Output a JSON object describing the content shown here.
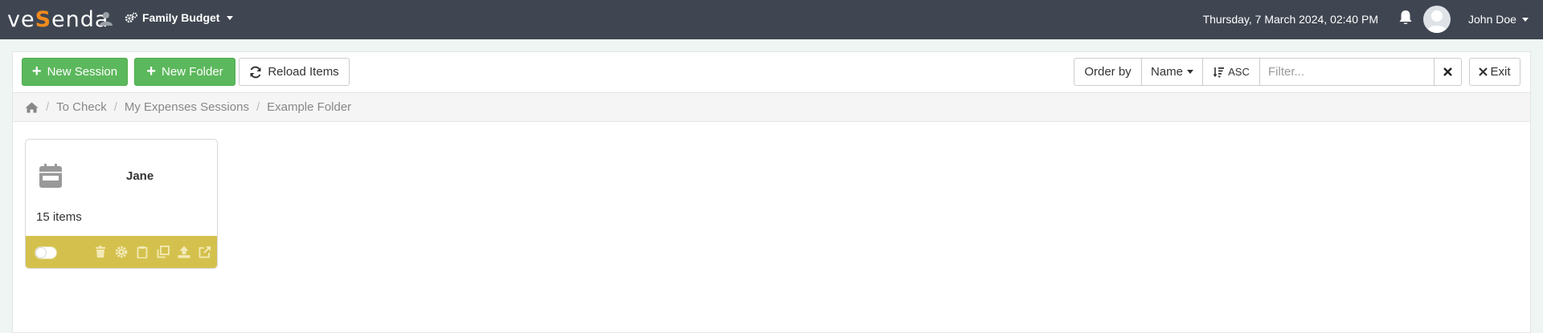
{
  "app": {
    "logo_text": "vesenda",
    "workspace": "Family Budget",
    "datetime": "Thursday, 7 March 2024, 02:40 PM",
    "user_name": "John Doe"
  },
  "toolbar": {
    "new_session": "New Session",
    "new_folder": "New Folder",
    "reload_items": "Reload Items",
    "order_by": "Order by",
    "order_field": "Name",
    "order_direction": "ASC",
    "filter_placeholder": "Filter...",
    "exit": "Exit"
  },
  "breadcrumb": {
    "items": [
      "To Check",
      "My Expenses Sessions",
      "Example Folder"
    ]
  },
  "cards": [
    {
      "title": "Jane",
      "count": "15 items",
      "icon": "calendar-icon",
      "footer_color": "#d4c14d",
      "toggle_on": false,
      "actions": [
        "trash-icon",
        "gear-icon",
        "clipboard-icon",
        "copy-icon",
        "upload-icon",
        "external-link-icon"
      ]
    }
  ],
  "colors": {
    "topbar": "#3f4651",
    "accent_green": "#5cb85c",
    "logo_accent": "#f08a1e"
  }
}
